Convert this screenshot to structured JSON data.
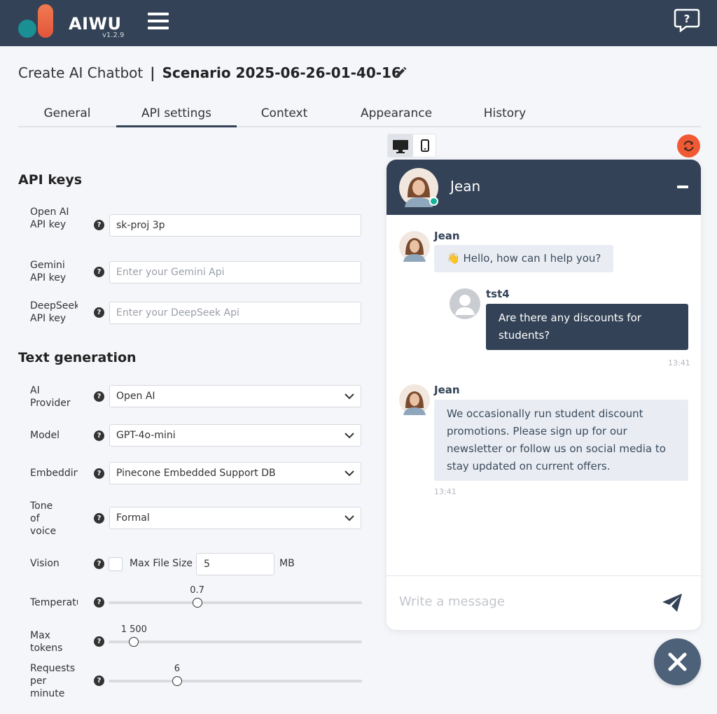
{
  "header": {
    "brand": "AIWU",
    "version": "v1.2.9"
  },
  "page": {
    "title_prefix": "Create AI Chatbot",
    "separator": "|",
    "scenario": "Scenario 2025-06-26-01-40-16"
  },
  "tabs": [
    {
      "label": "General"
    },
    {
      "label": "API settings"
    },
    {
      "label": "Context"
    },
    {
      "label": "Appearance"
    },
    {
      "label": "History"
    }
  ],
  "api_keys": {
    "section_title": "API keys",
    "openai": {
      "label": "Open AI API key",
      "value": "sk-proj                                                      3p"
    },
    "gemini": {
      "label": "Gemini API key",
      "placeholder": "Enter your Gemini Api"
    },
    "deepseek": {
      "label": "DeepSeek API key",
      "placeholder": "Enter your DeepSeek Api"
    }
  },
  "text_generation": {
    "section_title": "Text generation",
    "provider": {
      "label": "AI Provider",
      "value": "Open AI"
    },
    "model": {
      "label": "Model",
      "value": "GPT-4o-mini"
    },
    "embedding": {
      "label": "Embedding",
      "value": "Pinecone Embedded Support DB"
    },
    "tone": {
      "label": "Tone of voice",
      "value": "Formal"
    },
    "vision": {
      "label": "Vision",
      "max_file_label": "Max File Size",
      "max_file_value": "5",
      "unit": "MB"
    },
    "temperature": {
      "label": "Temperature",
      "value": "0.7",
      "level": 0.35
    },
    "max_tokens": {
      "label": "Max tokens",
      "value": "1 500",
      "level": 0.1
    },
    "rpm": {
      "label": "Requests per minute",
      "value": "6",
      "level": 0.27
    }
  },
  "chat": {
    "bot_name": "Jean",
    "messages": [
      {
        "sender": "Jean",
        "text": "👋 Hello, how can I help you?"
      },
      {
        "sender": "tst4",
        "text": "Are there any discounts for students?",
        "time": "13:41"
      },
      {
        "sender": "Jean",
        "text": "We occasionally run student discount promotions. Please sign up for our newsletter or follow us on social media to stay updated on current offers.",
        "time": "13:41"
      }
    ],
    "input_placeholder": "Write a message"
  },
  "colors": {
    "header_bg": "#334256",
    "accent": "#ef5a34",
    "online": "#12b59a"
  }
}
